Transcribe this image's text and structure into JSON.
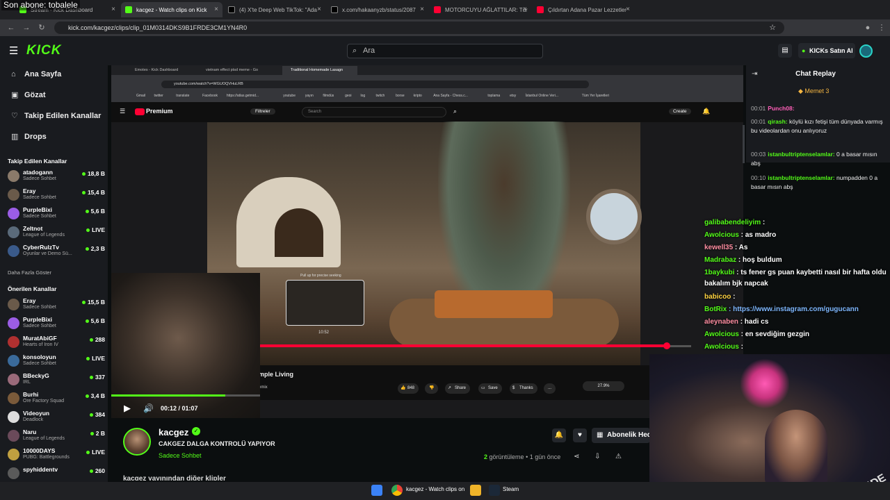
{
  "browser": {
    "overlay_text": "Son abone: tobalele",
    "tabs": [
      {
        "label": "Stream - Kick Dashboard"
      },
      {
        "label": "kacgez - Watch clips on Kick"
      },
      {
        "label": "(4) X'te Deep Web TikTok: \"Ada"
      },
      {
        "label": "x.com/hakaanyzb/status/2087"
      },
      {
        "label": "MOTORCUYU AĞLATTILAR: Tür"
      },
      {
        "label": "Çıldırtan Adana Pazar Lezzetler"
      }
    ],
    "url": "kick.com/kacgez/clips/clip_01M0314DKS9B1FRDE3CM1YN4R0"
  },
  "kick": {
    "logo": "KICK",
    "search_placeholder": "Ara",
    "buy_kicks": "KICKs Satın Al",
    "nav": [
      {
        "label": "Ana Sayfa",
        "icon": "home-icon"
      },
      {
        "label": "Gözat",
        "icon": "browse-icon"
      },
      {
        "label": "Takip Edilen Kanallar",
        "icon": "heart-icon"
      },
      {
        "label": "Drops",
        "icon": "drops-icon"
      }
    ],
    "followed_header": "Takip Edilen Kanallar",
    "followed": [
      {
        "name": "atadogann",
        "sub": "Sadece Sohbet",
        "viewers": "18,8 B",
        "color": "#8a7a6a"
      },
      {
        "name": "Eray",
        "sub": "Sadece Sohbet",
        "viewers": "15,4 B",
        "color": "#6a5a4a"
      },
      {
        "name": "PurpleBixi",
        "sub": "Sadece Sohbet",
        "viewers": "5,6 B",
        "color": "#9b5de5"
      },
      {
        "name": "Zeltnot",
        "sub": "League of Legends",
        "viewers": "LIVE",
        "color": "#5a6a7a"
      },
      {
        "name": "CyberRulzTv",
        "sub": "Oyunlar ve Demo Sü...",
        "viewers": "2,3 B",
        "color": "#3a5a8a"
      }
    ],
    "show_more": "Daha Fazla Göster",
    "recommended_header": "Önerilen Kanallar",
    "recommended": [
      {
        "name": "Eray",
        "sub": "Sadece Sohbet",
        "viewers": "15,5 B",
        "color": "#6a5a4a"
      },
      {
        "name": "PurpleBixi",
        "sub": "Sadece Sohbet",
        "viewers": "5,6 B",
        "color": "#9b5de5"
      },
      {
        "name": "MuratAbiGF",
        "sub": "Hearts of Iron IV",
        "viewers": "288",
        "color": "#b03030"
      },
      {
        "name": "konsoloyun",
        "sub": "Sadece Sohbet",
        "viewers": "LIVE",
        "color": "#3a6a9a"
      },
      {
        "name": "BBeckyG",
        "sub": "IRL",
        "viewers": "337",
        "color": "#9a6a7a"
      },
      {
        "name": "Burhi",
        "sub": "Ore Factory Squad",
        "viewers": "3,4 B",
        "color": "#7a5a3a"
      },
      {
        "name": "Videoyun",
        "sub": "Deadlock",
        "viewers": "384",
        "color": "#dddddd"
      },
      {
        "name": "Naru",
        "sub": "League of Legends",
        "viewers": "2 B",
        "color": "#6a4a5a"
      },
      {
        "name": "10000DAYS",
        "sub": "PUBG: Battlegrounds",
        "viewers": "LIVE",
        "color": "#c0a040"
      },
      {
        "name": "spyhiddentv",
        "sub": "",
        "viewers": "260",
        "color": "#5a5a5a"
      }
    ],
    "player": {
      "time": "00:12 / 01:07",
      "progress": 0.18
    },
    "clip": {
      "channel": "kacgez",
      "title": "CAKGEZ DALGA KONTROLÜ YAPIYOR",
      "category": "Sadece Sohbet",
      "views_count": "2",
      "views_label": " görüntüleme",
      "age": " • 1 gün önce",
      "subscribe": "Abonelik Hediye Et",
      "other_clips": "kacgez yayınından diğer klipler"
    },
    "chat": {
      "title": "Chat Replay",
      "pinned": "Memet 3",
      "messages": [
        {
          "time": "00:01",
          "user": "Punch08:",
          "text": "",
          "color": "#ff5fb8"
        },
        {
          "time": "00:01",
          "user": "qirash:",
          "text": "köylü kızı fetişi tüm dünyada varmış bu videolardan onu anlıyoruz",
          "color": "#53fc18"
        },
        {
          "time": "00:03",
          "user": "istanbultriptenselamlar:",
          "text": "0 a basar mısın abş",
          "color": "#53fc18"
        },
        {
          "time": "00:10",
          "user": "istanbultriptenselamlar:",
          "text": "numpadden 0 a basar mısın abş",
          "color": "#53fc18"
        }
      ]
    }
  },
  "embedded": {
    "tabs": [
      {
        "label": "Emotes - Kick Dashboard"
      },
      {
        "label": "vietnam effect ptsd meme - Go"
      },
      {
        "label": "Traditional Homemade Lasagn"
      }
    ],
    "url": "youtube.com/watch?v=WGUOQVHuLRB",
    "bookmarks": [
      "Gmail",
      "twitter",
      "translate",
      "Facebook",
      "https://atlas.getmid...",
      "youtube",
      "yayın",
      "filmdüs",
      "geoi",
      "log",
      "twitch",
      "borse",
      "kripto",
      "Ana Sayfa - Chess.c...",
      "toplama",
      "etsy",
      "İstanbul Online Veri...",
      "Tüm Yer İşaretleri"
    ],
    "yt_logo": "Premium",
    "yt_filter": "Filtreler",
    "yt_search": "Search",
    "yt_create": "Create",
    "yt_title": "mple Living",
    "yt_remix": "emix",
    "preview_label": "Pull up for precise seeking",
    "preview_time": "10:52",
    "yt_buttons": [
      "848",
      "",
      "Share",
      "Save",
      "Thanks",
      "..."
    ],
    "yt_percent": "27.9%"
  },
  "stream_chat": [
    {
      "user": "galibabendeliyim",
      "text": ": ",
      "color": "#53fc18"
    },
    {
      "user": "Awolcious",
      "text": ": as madro",
      "color": "#53fc18"
    },
    {
      "user": "kewell35",
      "text": ": As",
      "color": "#ff8da1"
    },
    {
      "user": "Madrabaz",
      "text": ": hoş buldum",
      "color": "#53fc18"
    },
    {
      "user": "1baykubi",
      "text": ": ts fener gs puan kaybetti nasıl bir hafta oldu",
      "color": "#53fc18"
    },
    {
      "user": "",
      "text": "bakalım bjk napcak",
      "color": "#ffffff"
    },
    {
      "user": "babicoo",
      "text": ": ",
      "color": "#ffd23f"
    },
    {
      "user": "BotRix",
      "text": ": https://www.instagram.com/gugucann",
      "color": "#53fc18"
    },
    {
      "user": "aleynaben",
      "text": ": hadi cs",
      "color": "#ff8da1"
    },
    {
      "user": "Awolcious",
      "text": ": en sevdiğim gezgin",
      "color": "#53fc18"
    },
    {
      "user": "Awolcious",
      "text": ": ",
      "color": "#53fc18"
    }
  ],
  "taskbar": {
    "chrome_label": "kacgez - Watch clips on",
    "steam_label": "Steam"
  }
}
